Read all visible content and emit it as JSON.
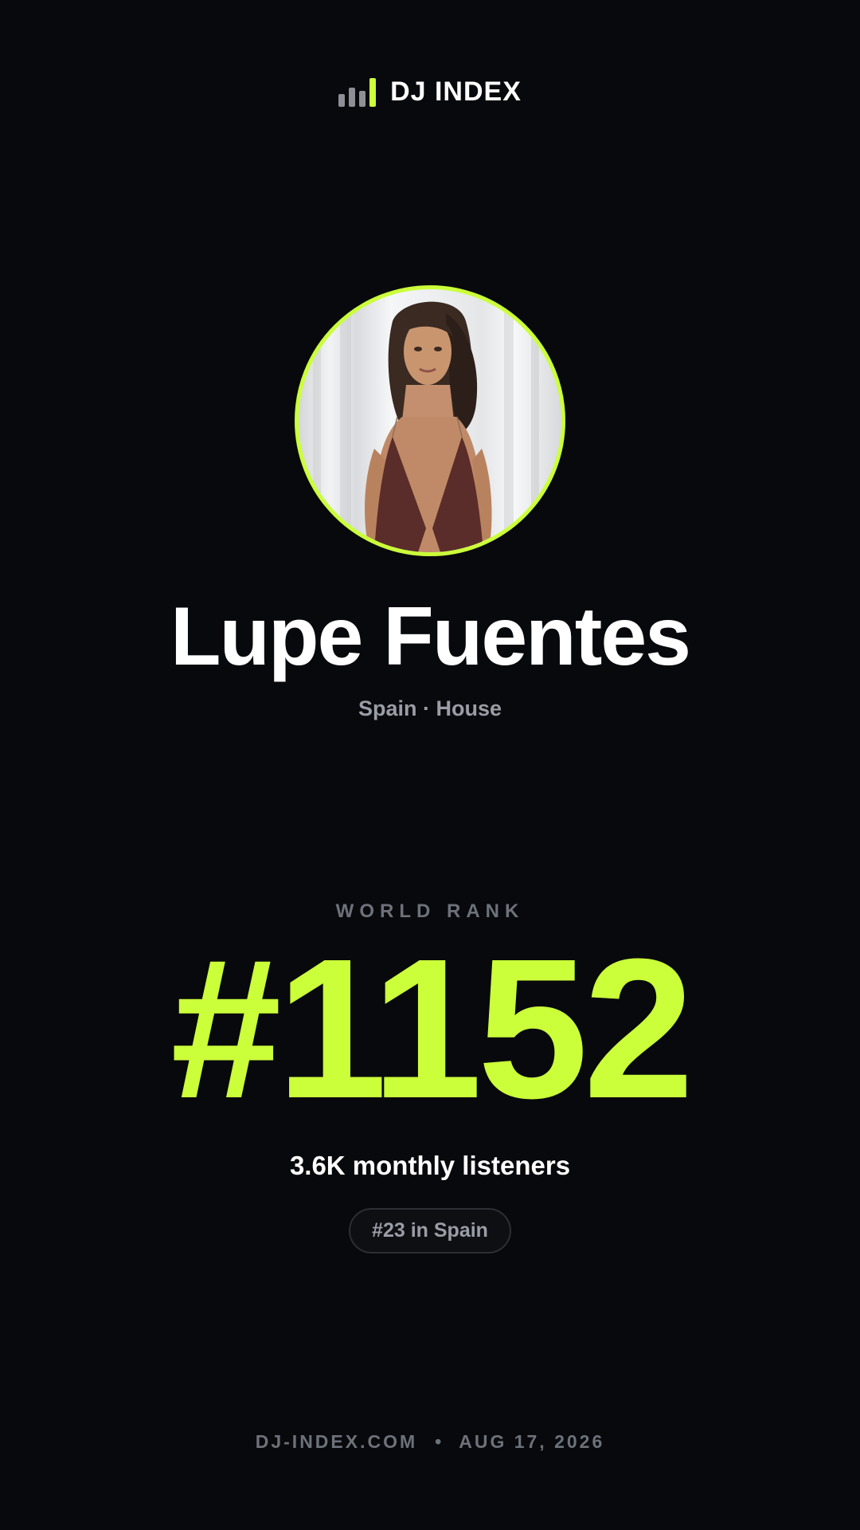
{
  "brand": {
    "name": "DJ INDEX",
    "accent_color": "#cbff3a",
    "logo_icon": "bar-chart-icon"
  },
  "artist": {
    "name": "Lupe Fuentes",
    "meta": "Spain · House",
    "photo": "artist-avatar"
  },
  "rank": {
    "label": "WORLD RANK",
    "value": "#1152",
    "listeners": "3.6K monthly listeners",
    "country_rank": "#23 in Spain"
  },
  "footer": {
    "site": "DJ-INDEX.COM",
    "separator": "•",
    "date": "AUG 17, 2026"
  }
}
